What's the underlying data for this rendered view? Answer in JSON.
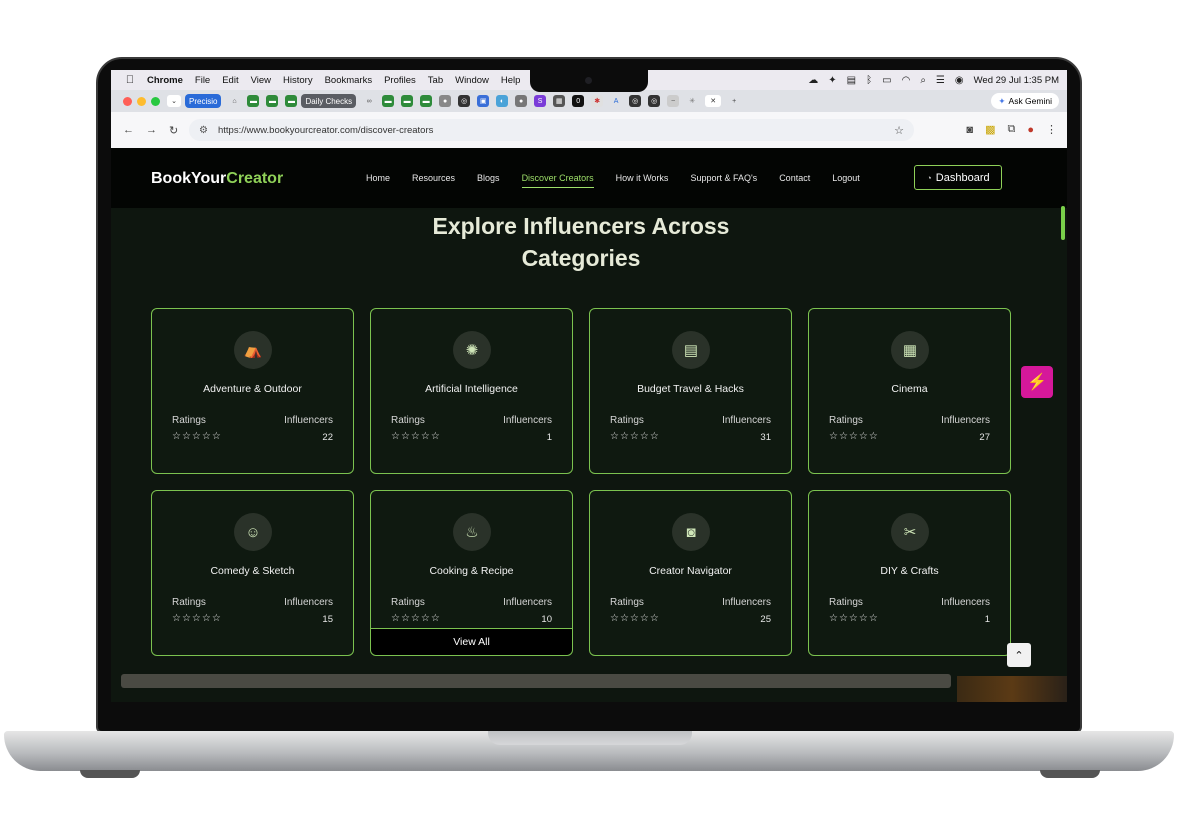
{
  "menubar": {
    "app": "Chrome",
    "items": [
      "File",
      "Edit",
      "View",
      "History",
      "Bookmarks",
      "Profiles",
      "Tab",
      "Window",
      "Help"
    ],
    "datetime": "Wed 29 Jul  1:35 PM"
  },
  "tabs": {
    "group1": "Precisio",
    "group2": "Daily Checks",
    "ask_gemini": "Ask Gemini"
  },
  "address": {
    "url": "https://www.bookyourcreator.com/discover-creators"
  },
  "site": {
    "logo_a": "BookYour",
    "logo_b": "Creator",
    "nav": [
      "Home",
      "Resources",
      "Blogs",
      "Discover Creators",
      "How it Works",
      "Support & FAQ's",
      "Contact",
      "Logout"
    ],
    "dashboard": "Dashboard",
    "heading_line1": "Explore Influencers Across",
    "heading_line2": "Categories",
    "ratings_label": "Ratings",
    "influencers_label": "Influencers",
    "stars": "☆☆☆☆☆",
    "view_all": "View All",
    "categories": [
      {
        "title": "Adventure & Outdoor",
        "count": "22",
        "icon": "tent-icon"
      },
      {
        "title": "Artificial Intelligence",
        "count": "1",
        "icon": "ai-chip-icon"
      },
      {
        "title": "Budget Travel & Hacks",
        "count": "31",
        "icon": "document-icon"
      },
      {
        "title": "Cinema",
        "count": "27",
        "icon": "clapperboard-icon"
      },
      {
        "title": "Comedy & Sketch",
        "count": "15",
        "icon": "performer-icon"
      },
      {
        "title": "Cooking & Recipe",
        "count": "10",
        "icon": "cooking-icon"
      },
      {
        "title": "Creator Navigator",
        "count": "25",
        "icon": "camera-icon"
      },
      {
        "title": "DIY & Crafts",
        "count": "1",
        "icon": "craft-icon"
      }
    ]
  }
}
